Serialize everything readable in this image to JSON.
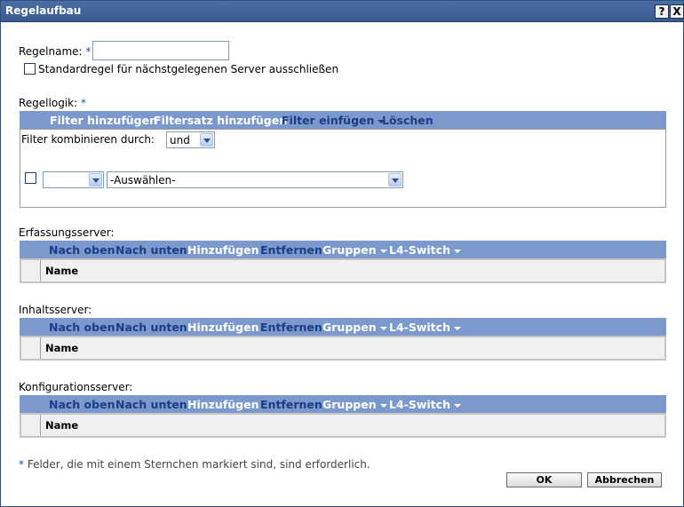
{
  "window": {
    "title": "Regelaufbau",
    "help_label": "?",
    "close_label": "X"
  },
  "rule_name": {
    "label": "Regelname:",
    "required_mark": "*",
    "value": ""
  },
  "exclude_default": {
    "label": "Standardregel für nächstgelegenen Server ausschließen",
    "checked": false
  },
  "rule_logic": {
    "label": "Regellogik:",
    "required_mark": "*",
    "toolbar": {
      "add_filter": "Filter hinzufügen",
      "add_filterset": "Filtersatz hinzufügen",
      "insert_filter": "Filter einfügen",
      "delete": "Löschen"
    },
    "combine_label": "Filter kombinieren durch:",
    "combine_value": "und",
    "row": {
      "first_select_value": "",
      "second_select_value": "-Auswählen-"
    }
  },
  "server_toolbar": {
    "move_up": "Nach oben",
    "move_down": "Nach unten",
    "add": "Hinzufügen",
    "remove": "Entfernen",
    "groups": "Gruppen",
    "l4_switch": "L4-Switch"
  },
  "sections": {
    "capture": {
      "label": "Erfassungsserver:",
      "column": "Name"
    },
    "content": {
      "label": "Inhaltsserver:",
      "column": "Name"
    },
    "config": {
      "label": "Konfigurationsserver:",
      "column": "Name"
    }
  },
  "footer": {
    "required_mark": "*",
    "note": "Felder, die mit einem Sternchen markiert sind, sind erforderlich."
  },
  "buttons": {
    "ok": "OK",
    "cancel": "Abbrechen"
  },
  "colors": {
    "titlebar": "#3f5f94",
    "toolbar": "#7b99cc",
    "toolbar_link_blue": "#1a3d86",
    "required_blue": "#1c4fa8"
  }
}
